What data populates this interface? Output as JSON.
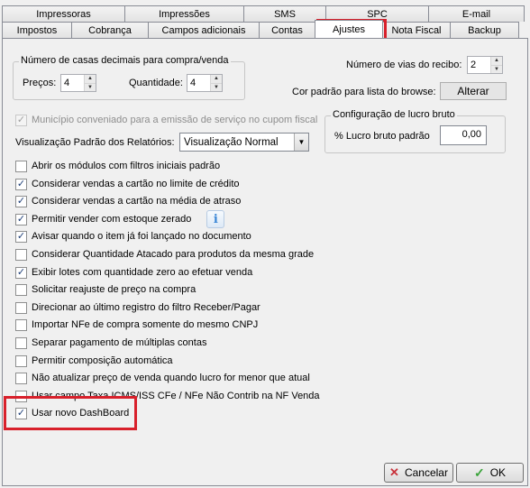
{
  "tabs_row1": [
    "Impressoras",
    "Impressões",
    "SMS",
    "SPC",
    "E-mail"
  ],
  "tabs_row2": [
    "Impostos",
    "Cobrança",
    "Campos adicionais",
    "Contas",
    "Ajustes",
    "Nota Fiscal",
    "Backup"
  ],
  "active_tab": "Ajustes",
  "decimals": {
    "legend": "Número de casas decimais para compra/venda",
    "precos_label": "Preços:",
    "precos_value": "4",
    "quantidade_label": "Quantidade:",
    "quantidade_value": "4"
  },
  "vias": {
    "label": "Número de vias do recibo:",
    "value": "2"
  },
  "browse": {
    "label": "Cor padrão para lista do browse:",
    "button": "Alterar"
  },
  "municipio": {
    "label": "Município conveniado para a emissão de serviço no cupom fiscal",
    "checked": true,
    "enabled": false
  },
  "lucro": {
    "legend": "Configuração de lucro bruto",
    "label": "% Lucro bruto padrão",
    "value": "0,00"
  },
  "relatorios": {
    "label": "Visualização Padrão dos Relatórios:",
    "selected": "Visualização Normal"
  },
  "options": [
    {
      "label": "Abrir os módulos com filtros iniciais padrão",
      "checked": false
    },
    {
      "label": "Considerar vendas a cartão no limite de crédito",
      "checked": true
    },
    {
      "label": "Considerar vendas a cartão na média de atraso",
      "checked": true
    },
    {
      "label": "Permitir vender com estoque zerado",
      "checked": true
    },
    {
      "label": "Avisar quando o item já foi lançado no documento",
      "checked": true
    },
    {
      "label": "Considerar Quantidade Atacado para produtos da mesma grade",
      "checked": false
    },
    {
      "label": "Exibir lotes com quantidade zero ao efetuar venda",
      "checked": true
    },
    {
      "label": "Solicitar reajuste de preço na compra",
      "checked": false
    },
    {
      "label": "Direcionar ao último registro do filtro Receber/Pagar",
      "checked": false
    },
    {
      "label": "Importar NFe de compra somente do mesmo CNPJ",
      "checked": false
    },
    {
      "label": "Separar pagamento de múltiplas contas",
      "checked": false
    },
    {
      "label": "Permitir composição automática",
      "checked": false
    },
    {
      "label": "Não atualizar preço de venda quando lucro for menor que atual",
      "checked": false
    },
    {
      "label": "Usar campo Taxa ICMS/ISS CFe / NFe Não Contrib na NF Venda",
      "checked": false
    },
    {
      "label": "Usar novo DashBoard",
      "checked": true
    }
  ],
  "icons": {
    "info": "info-icon",
    "cancel": "cancel-x-icon",
    "ok": "checkmark-icon"
  },
  "colors": {
    "highlight": "#d8202b",
    "check": "#1e3f78",
    "info": "#3a86d6"
  },
  "buttons": {
    "cancel": "Cancelar",
    "ok": "OK"
  }
}
